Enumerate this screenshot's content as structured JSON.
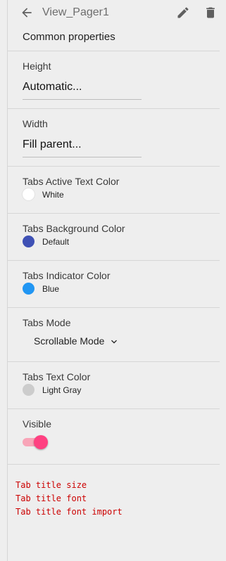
{
  "header": {
    "component_name": "View_Pager1",
    "back_icon": "arrow-back-icon",
    "edit_icon": "pencil-icon",
    "delete_icon": "trash-icon",
    "icon_color": "#5f5f5f"
  },
  "section": {
    "title": "Common properties"
  },
  "properties": {
    "height": {
      "label": "Height",
      "value": "Automatic..."
    },
    "width": {
      "label": "Width",
      "value": "Fill parent..."
    },
    "tabs_active_text_color": {
      "label": "Tabs Active Text Color",
      "color_name": "White",
      "color": "#ffffff"
    },
    "tabs_background_color": {
      "label": "Tabs Background Color",
      "color_name": "Default",
      "color": "#3f51b5"
    },
    "tabs_indicator_color": {
      "label": "Tabs Indicator Color",
      "color_name": "Blue",
      "color": "#2196f3"
    },
    "tabs_mode": {
      "label": "Tabs Mode",
      "value": "Scrollable Mode",
      "chevron_icon": "chevron-down-icon"
    },
    "tabs_text_color": {
      "label": "Tabs Text Color",
      "color_name": "Light Gray",
      "color": "#cccccc"
    },
    "visible": {
      "label": "Visible",
      "checked": true,
      "track_color": "#f8a5b8",
      "thumb_color": "#ff4081"
    }
  },
  "warnings": {
    "color": "#cc0000",
    "lines": [
      "Tab title size",
      "Tab title font",
      "Tab title font import"
    ]
  }
}
